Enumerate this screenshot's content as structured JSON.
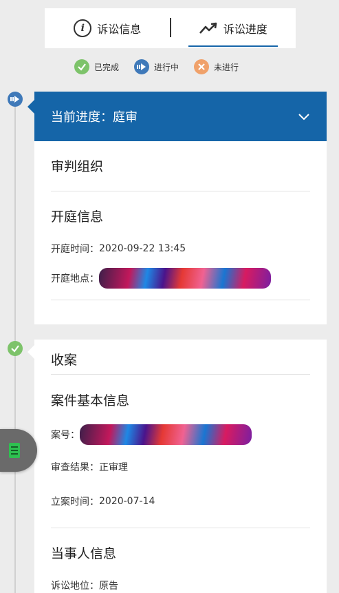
{
  "tabs": [
    {
      "label": "诉讼信息",
      "icon": "info-icon"
    },
    {
      "label": "诉讼进度",
      "icon": "trend-icon"
    }
  ],
  "legend": {
    "completed": "已完成",
    "in_progress": "进行中",
    "not_started": "未进行"
  },
  "colors": {
    "primary": "#1565a8",
    "completed": "#7dc36a",
    "in_progress": "#3f79b9",
    "not_started": "#f0a16a"
  },
  "current": {
    "title": "当前进度：庭审",
    "sec_judge_org": "审判组织",
    "sec_hearing_info": "开庭信息",
    "hearing_time_label": "开庭时间：",
    "hearing_time": "2020-09-22 13:45",
    "hearing_place_label": "开庭地点："
  },
  "filing": {
    "title": "收案",
    "sec_case_basic": "案件基本信息",
    "case_no_label": "案号：",
    "review_result_label": "审查结果：",
    "review_result": "正审理",
    "filing_date_label": "立案时间：",
    "filing_date": "2020-07-14",
    "sec_party_info": "当事人信息",
    "party_role_label": "诉讼地位：",
    "party_role": "原告"
  }
}
